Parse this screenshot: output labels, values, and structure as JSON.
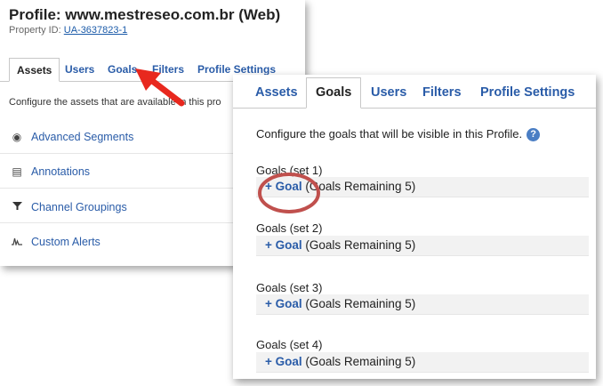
{
  "back_panel": {
    "title": "Profile: www.mestreseo.com.br (Web)",
    "property_label": "Property ID:",
    "property_id": "UA-3637823-1",
    "tabs": [
      {
        "label": "Assets",
        "active": true
      },
      {
        "label": "Users"
      },
      {
        "label": "Goals"
      },
      {
        "label": "Filters"
      },
      {
        "label": "Profile Settings"
      }
    ],
    "description": "Configure the assets that are available in this pro",
    "menu": [
      {
        "label": "Advanced Segments",
        "icon": "segments-icon"
      },
      {
        "label": "Annotations",
        "icon": "annotations-icon"
      },
      {
        "label": "Channel Groupings",
        "icon": "filter-icon"
      },
      {
        "label": "Custom Alerts",
        "icon": "alerts-icon"
      }
    ]
  },
  "front_panel": {
    "tabs": [
      {
        "label": "Assets"
      },
      {
        "label": "Goals",
        "active": true
      },
      {
        "label": "Users"
      },
      {
        "label": "Filters"
      },
      {
        "label": "Profile Settings"
      }
    ],
    "description": "Configure the goals that will be visible in this Profile.",
    "help": "?",
    "goal_sets": [
      {
        "label": "Goals (set 1)",
        "add_label": "+ Goal",
        "remaining": "(Goals Remaining 5)"
      },
      {
        "label": "Goals (set 2)",
        "add_label": "+ Goal",
        "remaining": "(Goals Remaining 5)"
      },
      {
        "label": "Goals (set 3)",
        "add_label": "+ Goal",
        "remaining": "(Goals Remaining 5)"
      },
      {
        "label": "Goals (set 4)",
        "add_label": "+ Goal",
        "remaining": "(Goals Remaining 5)"
      }
    ]
  },
  "annotations": {
    "arrow_color": "#e8281e",
    "circle_color": "#c0504d"
  }
}
